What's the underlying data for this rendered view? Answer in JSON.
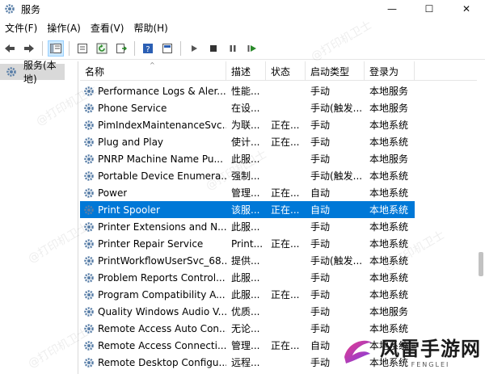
{
  "window": {
    "title": "服务",
    "minimize": "—",
    "maximize": "☐",
    "close": "✕"
  },
  "menu": [
    "文件(F)",
    "操作(A)",
    "查看(V)",
    "帮助(H)"
  ],
  "tree": {
    "item_label": "服务(本地)"
  },
  "columns": [
    "名称",
    "描述",
    "状态",
    "启动类型",
    "登录为"
  ],
  "rows": [
    {
      "name": "Performance Logs & Aler...",
      "desc": "性能...",
      "status": "",
      "start": "手动",
      "logon": "本地服务"
    },
    {
      "name": "Phone Service",
      "desc": "在设...",
      "status": "",
      "start": "手动(触发...",
      "logon": "本地服务"
    },
    {
      "name": "PimIndexMaintenanceSvc...",
      "desc": "为联...",
      "status": "正在...",
      "start": "手动",
      "logon": "本地系统"
    },
    {
      "name": "Plug and Play",
      "desc": "使计...",
      "status": "正在...",
      "start": "手动",
      "logon": "本地系统"
    },
    {
      "name": "PNRP Machine Name Pu...",
      "desc": "此服...",
      "status": "",
      "start": "手动",
      "logon": "本地服务"
    },
    {
      "name": "Portable Device Enumera...",
      "desc": "强制...",
      "status": "",
      "start": "手动(触发...",
      "logon": "本地系统"
    },
    {
      "name": "Power",
      "desc": "管理...",
      "status": "正在...",
      "start": "自动",
      "logon": "本地系统"
    },
    {
      "name": "Print Spooler",
      "desc": "该服...",
      "status": "正在...",
      "start": "自动",
      "logon": "本地系统",
      "selected": true
    },
    {
      "name": "Printer Extensions and N...",
      "desc": "此服...",
      "status": "",
      "start": "手动",
      "logon": "本地系统"
    },
    {
      "name": "Printer Repair Service",
      "desc": "Print...",
      "status": "正在...",
      "start": "手动",
      "logon": "本地系统"
    },
    {
      "name": "PrintWorkflowUserSvc_68...",
      "desc": "提供...",
      "status": "",
      "start": "手动(触发...",
      "logon": "本地系统"
    },
    {
      "name": "Problem Reports Control...",
      "desc": "此服...",
      "status": "",
      "start": "手动",
      "logon": "本地系统"
    },
    {
      "name": "Program Compatibility A...",
      "desc": "此服...",
      "status": "正在...",
      "start": "手动",
      "logon": "本地系统"
    },
    {
      "name": "Quality Windows Audio V...",
      "desc": "优质...",
      "status": "",
      "start": "手动",
      "logon": "本地服务"
    },
    {
      "name": "Remote Access Auto Con...",
      "desc": "无论...",
      "status": "",
      "start": "手动",
      "logon": "本地系统"
    },
    {
      "name": "Remote Access Connecti...",
      "desc": "管理...",
      "status": "正在...",
      "start": "自动",
      "logon": "本地系统"
    },
    {
      "name": "Remote Desktop Configu...",
      "desc": "远程...",
      "status": "",
      "start": "手动",
      "logon": "本地系统"
    }
  ],
  "watermark": "@打印机卫士",
  "logo": {
    "cn": "风雷手游网",
    "en": "FENGLEI"
  },
  "colors": {
    "selection": "#0078d7",
    "toolbar_selected": "#cce8ff",
    "tree_selected": "#d9d9d9"
  }
}
